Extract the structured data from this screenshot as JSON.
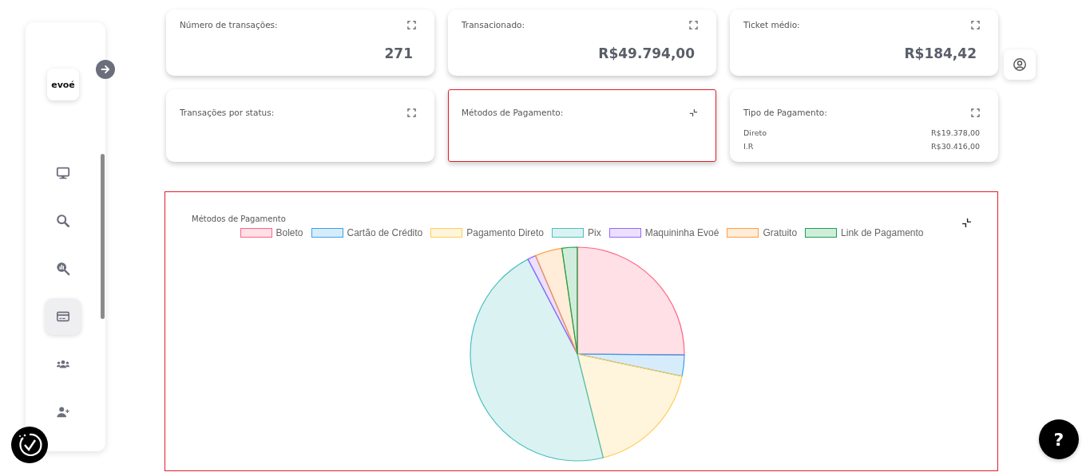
{
  "sidebar": {
    "logo": "evoé",
    "items": [
      {
        "kind": "monitor",
        "selected": false
      },
      {
        "kind": "search",
        "selected": false
      },
      {
        "kind": "analytics",
        "selected": false
      },
      {
        "kind": "card",
        "selected": true
      },
      {
        "kind": "group",
        "selected": false
      },
      {
        "kind": "add-user",
        "selected": false
      }
    ]
  },
  "cards": [
    {
      "kind": "value",
      "title": "Número de transações:",
      "value": "271",
      "expanded": false,
      "highlighted": false
    },
    {
      "kind": "value",
      "title": "Transacionado:",
      "value": "R$49.794,00",
      "expanded": false,
      "highlighted": false
    },
    {
      "kind": "value",
      "title": "Ticket médio:",
      "value": "R$184,42",
      "expanded": false,
      "highlighted": false
    },
    {
      "kind": "empty",
      "title": "Transações por status:",
      "expanded": false,
      "highlighted": false
    },
    {
      "kind": "empty",
      "title": "Métodos de Pagamento:",
      "expanded": true,
      "highlighted": true
    },
    {
      "kind": "list",
      "title": "Tipo de Pagamento:",
      "expanded": false,
      "highlighted": false,
      "rows": [
        {
          "label": "Direto",
          "value": "R$19.378,00"
        },
        {
          "label": "I.R",
          "value": "R$30.416,00"
        }
      ]
    }
  ],
  "chart_panel": {
    "title": "Métodos de Pagamento",
    "highlighted": true,
    "expanded": true,
    "legend": [
      {
        "label": "Boleto",
        "color": "#ff6384"
      },
      {
        "label": "Cartão de Crédito",
        "color": "#36a2eb"
      },
      {
        "label": "Pagamento Direto",
        "color": "#ffcd56"
      },
      {
        "label": "Pix",
        "color": "#4bc0c0"
      },
      {
        "label": "Maquininha Evoé",
        "color": "#9966ff"
      },
      {
        "label": "Gratuito",
        "color": "#ff9f40"
      },
      {
        "label": "Link de Pagamento",
        "color": "#16a34a"
      }
    ]
  },
  "help_button": {
    "label": "?"
  }
}
